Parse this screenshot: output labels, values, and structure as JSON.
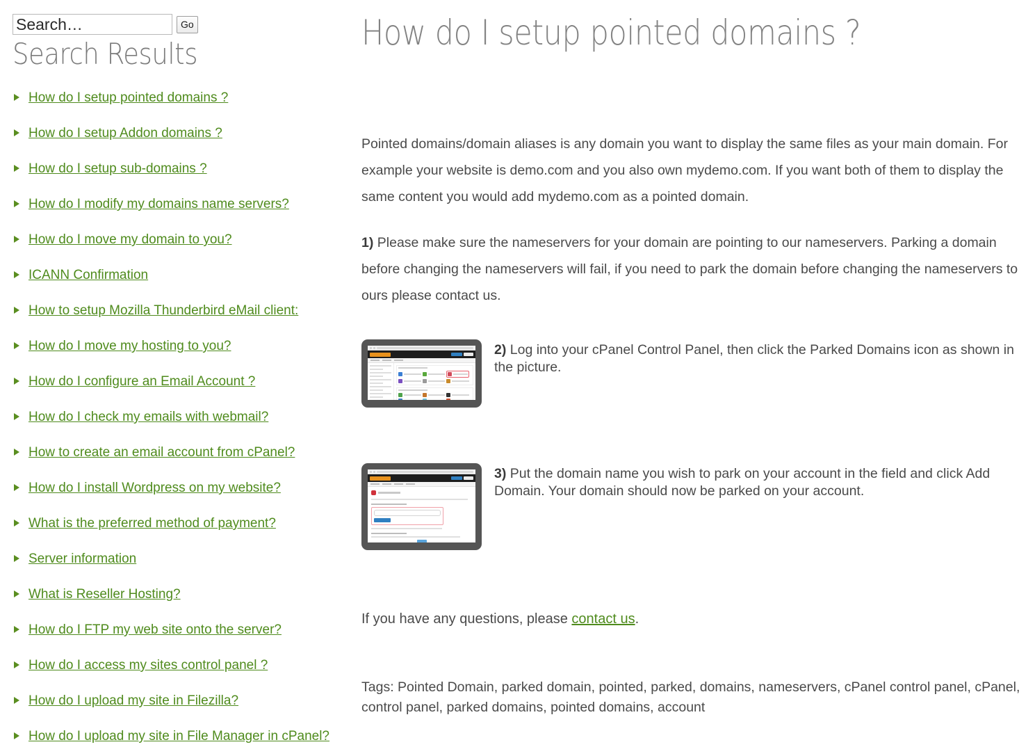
{
  "sidebar": {
    "search": {
      "placeholder": "Search…",
      "value": "",
      "go_label": "Go"
    },
    "title": "Search Results",
    "results": [
      {
        "label": "How do I setup pointed domains ?"
      },
      {
        "label": "How do I setup Addon domains ?"
      },
      {
        "label": "How do I setup sub-domains ?"
      },
      {
        "label": "How do I modify my domains name servers?"
      },
      {
        "label": "How do I move my domain to you?"
      },
      {
        "label": "ICANN Confirmation"
      },
      {
        "label": "How to setup Mozilla Thunderbird eMail client:"
      },
      {
        "label": "How do I move my hosting to you?"
      },
      {
        "label": "How do I configure an Email Account ?"
      },
      {
        "label": "How do I check my emails with webmail?"
      },
      {
        "label": "How to create an email account from cPanel?"
      },
      {
        "label": "How do I install Wordpress on my website?"
      },
      {
        "label": "What is the preferred method of payment?"
      },
      {
        "label": "Server information"
      },
      {
        "label": "What is Reseller Hosting?"
      },
      {
        "label": "How do I FTP my web site onto the server?"
      },
      {
        "label": "How do I access my sites control panel ?"
      },
      {
        "label": "How do I upload my site in Filezilla?"
      },
      {
        "label": "How do I upload my site in File Manager in cPanel?"
      }
    ]
  },
  "article": {
    "title": "How do I setup pointed domains ?",
    "intro": "Pointed domains/domain aliases is any domain you want to display the same files as your main domain.  For example your website is demo.com and you also own mydemo.com.  If you want both of them to display the same content you would add mydemo.com as a pointed domain.",
    "step1": {
      "number": "1)",
      "text": " Please make sure the nameservers for your domain are pointing to our nameservers. Parking a domain before changing the nameservers will fail, if you need to park the domain before changing the nameservers to ours please contact us."
    },
    "step2": {
      "number": "2)",
      "text": " Log into your cPanel Control Panel, then click the Parked Domains icon as shown in the picture.",
      "image_alt": "cpanel-home-parked-domains-screenshot"
    },
    "step3": {
      "number": "3)",
      "text": " Put the domain name you wish to park on your account in the field and click Add Domain. Your domain should now be parked on your account.",
      "image_alt": "cpanel-parked-domains-form-screenshot"
    },
    "closing": {
      "before_link": "If you have any questions, please ",
      "link_label": "contact us",
      "after_link": "."
    },
    "tags_label": "Tags:",
    "tags_text": "Tags: Pointed Domain, parked domain, pointed, parked, domains, nameservers, cPanel control panel, cPanel, control panel, parked domains, pointed domains, account"
  },
  "colors": {
    "link_green": "#4f8b1d",
    "bullet_green": "#5a8e20",
    "heading_gray": "#838383",
    "body_gray": "#4a4a4a",
    "device_bezel": "#555555",
    "cpanel_orange": "#e8911c",
    "highlight_red": "#e8616d"
  }
}
